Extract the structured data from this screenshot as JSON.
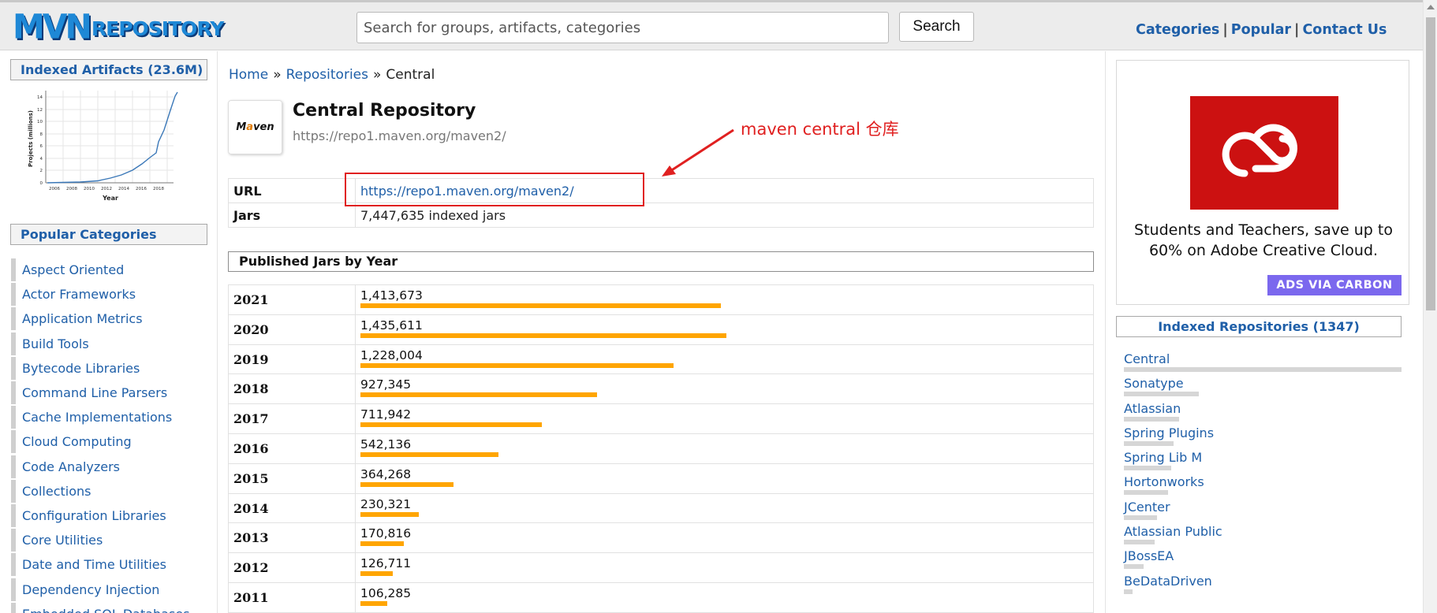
{
  "header": {
    "logo_mvn": "MVN",
    "logo_repo": "REPOSITORY",
    "search_placeholder": "Search for groups, artifacts, categories",
    "search_button": "Search",
    "nav": [
      "Categories",
      "Popular",
      "Contact Us"
    ],
    "nav_separator": "|"
  },
  "left": {
    "indexed_artifacts": "Indexed Artifacts (23.6M)",
    "growth_chart": {
      "ylabel": "Projects (millions)",
      "xlabel": "Year",
      "yticks": [
        "0",
        "2",
        "4",
        "6",
        "8",
        "10",
        "12",
        "14"
      ],
      "xticks": [
        "2006",
        "2008",
        "2010",
        "2012",
        "2014",
        "2016",
        "2018"
      ]
    },
    "popular_categories": "Popular Categories",
    "categories": [
      "Aspect Oriented",
      "Actor Frameworks",
      "Application Metrics",
      "Build Tools",
      "Bytecode Libraries",
      "Command Line Parsers",
      "Cache Implementations",
      "Cloud Computing",
      "Code Analyzers",
      "Collections",
      "Configuration Libraries",
      "Core Utilities",
      "Date and Time Utilities",
      "Dependency Injection",
      "Embedded SQL Databases"
    ]
  },
  "main": {
    "breadcrumb": [
      "Home",
      "Repositories",
      "Central"
    ],
    "breadcrumb_sep": "»",
    "repo_logo_text_a": "M",
    "repo_logo_text_b": "a",
    "repo_logo_text_c": "ven",
    "title": "Central Repository",
    "subtitle": "https://repo1.maven.org/maven2/",
    "annotation": "maven central 仓库",
    "info": {
      "url_label": "URL",
      "url_value": "https://repo1.maven.org/maven2/",
      "jars_label": "Jars",
      "jars_value": "7,447,635 indexed jars"
    },
    "published_heading": "Published Jars by Year"
  },
  "chart_data": {
    "type": "bar",
    "title": "Published Jars by Year",
    "categories": [
      "2021",
      "2020",
      "2019",
      "2018",
      "2017",
      "2016",
      "2015",
      "2014",
      "2013",
      "2012",
      "2011"
    ],
    "values": [
      1413673,
      1435611,
      1228004,
      927345,
      711942,
      542136,
      364268,
      230321,
      170816,
      126711,
      106285
    ],
    "labels": [
      "1,413,673",
      "1,435,611",
      "1,228,004",
      "927,345",
      "711,942",
      "542,136",
      "364,268",
      "230,321",
      "170,816",
      "126,711",
      "106,285"
    ],
    "color": "#ffa500"
  },
  "right": {
    "ad_text": "Students and Teachers, save up to 60% on Adobe Creative Cloud.",
    "ad_carbon": "ADS VIA CARBON",
    "indexed_repositories": "Indexed Repositories (1347)",
    "repositories": [
      {
        "name": "Central",
        "share": 1.0
      },
      {
        "name": "Sonatype",
        "share": 0.27
      },
      {
        "name": "Atlassian",
        "share": 0.2
      },
      {
        "name": "Spring Plugins",
        "share": 0.18
      },
      {
        "name": "Spring Lib M",
        "share": 0.17
      },
      {
        "name": "Hortonworks",
        "share": 0.16
      },
      {
        "name": "JCenter",
        "share": 0.12
      },
      {
        "name": "Atlassian Public",
        "share": 0.11
      },
      {
        "name": "JBossEA",
        "share": 0.07
      },
      {
        "name": "BeDataDriven",
        "share": 0.03
      }
    ]
  },
  "colors": {
    "link": "#1f5fa8",
    "bar": "#ffa500",
    "annotation": "#e02020",
    "ad_red": "#cc1111",
    "carbon": "#7b68ee"
  }
}
